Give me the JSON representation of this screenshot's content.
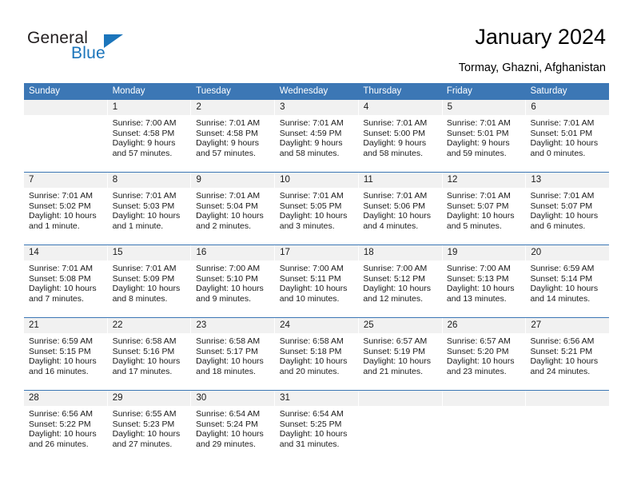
{
  "brand": {
    "name_primary": "General",
    "name_secondary": "Blue",
    "primary_color": "#231f20",
    "secondary_color": "#1b75bb"
  },
  "header": {
    "title": "January 2024",
    "subtitle": "Tormay, Ghazni, Afghanistan"
  },
  "calendar": {
    "header_color": "#3c77b5",
    "number_row_color": "#f1f1f1",
    "weekdays": [
      "Sunday",
      "Monday",
      "Tuesday",
      "Wednesday",
      "Thursday",
      "Friday",
      "Saturday"
    ],
    "weeks": [
      [
        {
          "day": "",
          "lines": []
        },
        {
          "day": "1",
          "lines": [
            "Sunrise: 7:00 AM",
            "Sunset: 4:58 PM",
            "Daylight: 9 hours",
            "and 57 minutes."
          ]
        },
        {
          "day": "2",
          "lines": [
            "Sunrise: 7:01 AM",
            "Sunset: 4:58 PM",
            "Daylight: 9 hours",
            "and 57 minutes."
          ]
        },
        {
          "day": "3",
          "lines": [
            "Sunrise: 7:01 AM",
            "Sunset: 4:59 PM",
            "Daylight: 9 hours",
            "and 58 minutes."
          ]
        },
        {
          "day": "4",
          "lines": [
            "Sunrise: 7:01 AM",
            "Sunset: 5:00 PM",
            "Daylight: 9 hours",
            "and 58 minutes."
          ]
        },
        {
          "day": "5",
          "lines": [
            "Sunrise: 7:01 AM",
            "Sunset: 5:01 PM",
            "Daylight: 9 hours",
            "and 59 minutes."
          ]
        },
        {
          "day": "6",
          "lines": [
            "Sunrise: 7:01 AM",
            "Sunset: 5:01 PM",
            "Daylight: 10 hours",
            "and 0 minutes."
          ]
        }
      ],
      [
        {
          "day": "7",
          "lines": [
            "Sunrise: 7:01 AM",
            "Sunset: 5:02 PM",
            "Daylight: 10 hours",
            "and 1 minute."
          ]
        },
        {
          "day": "8",
          "lines": [
            "Sunrise: 7:01 AM",
            "Sunset: 5:03 PM",
            "Daylight: 10 hours",
            "and 1 minute."
          ]
        },
        {
          "day": "9",
          "lines": [
            "Sunrise: 7:01 AM",
            "Sunset: 5:04 PM",
            "Daylight: 10 hours",
            "and 2 minutes."
          ]
        },
        {
          "day": "10",
          "lines": [
            "Sunrise: 7:01 AM",
            "Sunset: 5:05 PM",
            "Daylight: 10 hours",
            "and 3 minutes."
          ]
        },
        {
          "day": "11",
          "lines": [
            "Sunrise: 7:01 AM",
            "Sunset: 5:06 PM",
            "Daylight: 10 hours",
            "and 4 minutes."
          ]
        },
        {
          "day": "12",
          "lines": [
            "Sunrise: 7:01 AM",
            "Sunset: 5:07 PM",
            "Daylight: 10 hours",
            "and 5 minutes."
          ]
        },
        {
          "day": "13",
          "lines": [
            "Sunrise: 7:01 AM",
            "Sunset: 5:07 PM",
            "Daylight: 10 hours",
            "and 6 minutes."
          ]
        }
      ],
      [
        {
          "day": "14",
          "lines": [
            "Sunrise: 7:01 AM",
            "Sunset: 5:08 PM",
            "Daylight: 10 hours",
            "and 7 minutes."
          ]
        },
        {
          "day": "15",
          "lines": [
            "Sunrise: 7:01 AM",
            "Sunset: 5:09 PM",
            "Daylight: 10 hours",
            "and 8 minutes."
          ]
        },
        {
          "day": "16",
          "lines": [
            "Sunrise: 7:00 AM",
            "Sunset: 5:10 PM",
            "Daylight: 10 hours",
            "and 9 minutes."
          ]
        },
        {
          "day": "17",
          "lines": [
            "Sunrise: 7:00 AM",
            "Sunset: 5:11 PM",
            "Daylight: 10 hours",
            "and 10 minutes."
          ]
        },
        {
          "day": "18",
          "lines": [
            "Sunrise: 7:00 AM",
            "Sunset: 5:12 PM",
            "Daylight: 10 hours",
            "and 12 minutes."
          ]
        },
        {
          "day": "19",
          "lines": [
            "Sunrise: 7:00 AM",
            "Sunset: 5:13 PM",
            "Daylight: 10 hours",
            "and 13 minutes."
          ]
        },
        {
          "day": "20",
          "lines": [
            "Sunrise: 6:59 AM",
            "Sunset: 5:14 PM",
            "Daylight: 10 hours",
            "and 14 minutes."
          ]
        }
      ],
      [
        {
          "day": "21",
          "lines": [
            "Sunrise: 6:59 AM",
            "Sunset: 5:15 PM",
            "Daylight: 10 hours",
            "and 16 minutes."
          ]
        },
        {
          "day": "22",
          "lines": [
            "Sunrise: 6:58 AM",
            "Sunset: 5:16 PM",
            "Daylight: 10 hours",
            "and 17 minutes."
          ]
        },
        {
          "day": "23",
          "lines": [
            "Sunrise: 6:58 AM",
            "Sunset: 5:17 PM",
            "Daylight: 10 hours",
            "and 18 minutes."
          ]
        },
        {
          "day": "24",
          "lines": [
            "Sunrise: 6:58 AM",
            "Sunset: 5:18 PM",
            "Daylight: 10 hours",
            "and 20 minutes."
          ]
        },
        {
          "day": "25",
          "lines": [
            "Sunrise: 6:57 AM",
            "Sunset: 5:19 PM",
            "Daylight: 10 hours",
            "and 21 minutes."
          ]
        },
        {
          "day": "26",
          "lines": [
            "Sunrise: 6:57 AM",
            "Sunset: 5:20 PM",
            "Daylight: 10 hours",
            "and 23 minutes."
          ]
        },
        {
          "day": "27",
          "lines": [
            "Sunrise: 6:56 AM",
            "Sunset: 5:21 PM",
            "Daylight: 10 hours",
            "and 24 minutes."
          ]
        }
      ],
      [
        {
          "day": "28",
          "lines": [
            "Sunrise: 6:56 AM",
            "Sunset: 5:22 PM",
            "Daylight: 10 hours",
            "and 26 minutes."
          ]
        },
        {
          "day": "29",
          "lines": [
            "Sunrise: 6:55 AM",
            "Sunset: 5:23 PM",
            "Daylight: 10 hours",
            "and 27 minutes."
          ]
        },
        {
          "day": "30",
          "lines": [
            "Sunrise: 6:54 AM",
            "Sunset: 5:24 PM",
            "Daylight: 10 hours",
            "and 29 minutes."
          ]
        },
        {
          "day": "31",
          "lines": [
            "Sunrise: 6:54 AM",
            "Sunset: 5:25 PM",
            "Daylight: 10 hours",
            "and 31 minutes."
          ]
        },
        {
          "day": "",
          "lines": []
        },
        {
          "day": "",
          "lines": []
        },
        {
          "day": "",
          "lines": []
        }
      ]
    ]
  }
}
